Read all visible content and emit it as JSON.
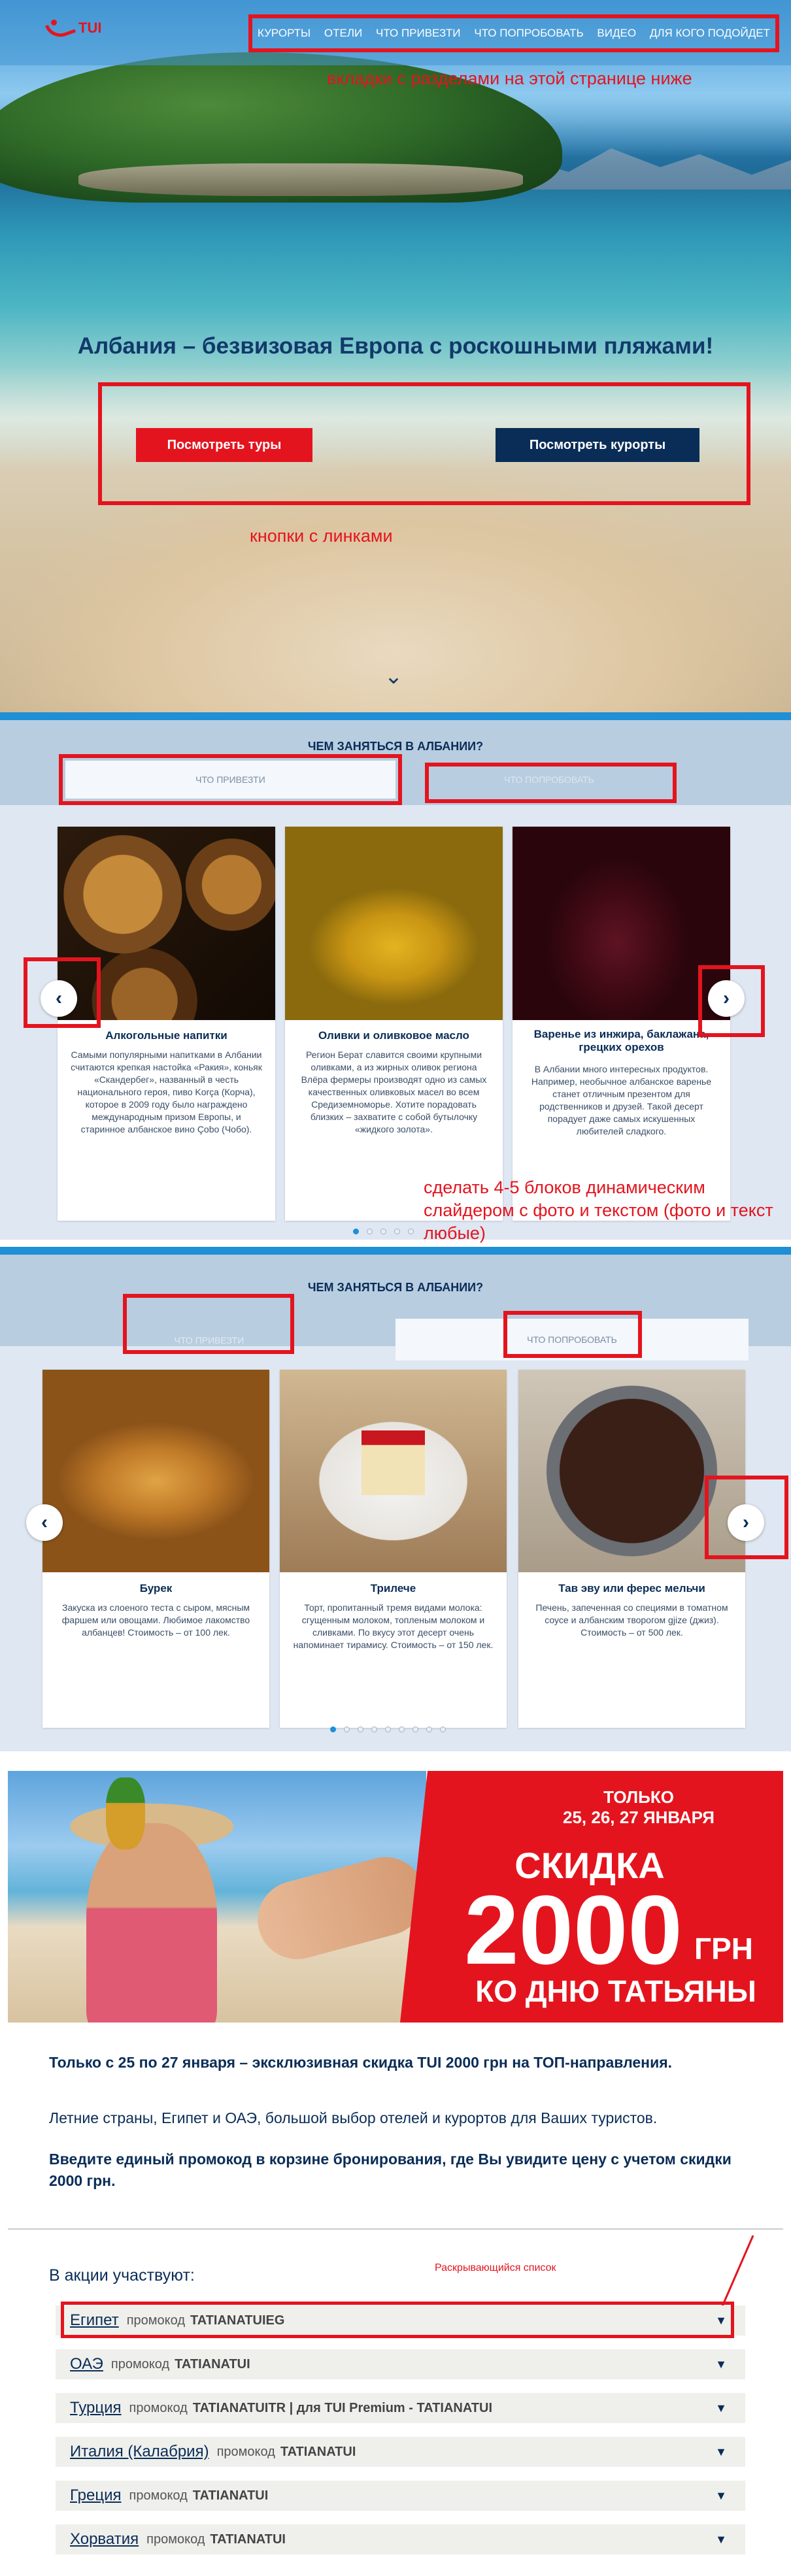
{
  "brand": {
    "logo_text": "TUI"
  },
  "nav": [
    "КУРОРТЫ",
    "ОТЕЛИ",
    "ЧТО ПРИВЕЗТИ",
    "ЧТО ПОПРОБОВАТЬ",
    "ВИДЕО",
    "ДЛЯ КОГО ПОДОЙДЕТ"
  ],
  "annotations": {
    "nav_note": "вкладки с разделами на этой странице ниже",
    "buttons_note": "кнопки с линками",
    "slider_note_1": "сделать 4-5 блоков динамическим",
    "slider_note_2": "слайдером с фото и текстом (фото и текст",
    "slider_note_3": "любые)",
    "dropdown_note": "Раскрывающийся список"
  },
  "hero": {
    "title": "Албания – безвизовая Европа с роскошными пляжами!",
    "btn_tours": "Посмотреть туры",
    "btn_resorts": "Посмотреть курорты",
    "scroll_icon": "chevron-down-icon"
  },
  "section1": {
    "title": "ЧЕМ ЗАНЯТЬСЯ В АЛБАНИИ?",
    "tab_bring": "ЧТО ПРИВЕЗТИ",
    "tab_try": "ЧТО ПОПРОБОВАТЬ",
    "active_tab": "ЧТО ПРИВЕЗТИ",
    "cards": [
      {
        "title": "Алкогольные напитки",
        "text": "Самыми популярными напитками в Албании считаются крепкая настойка «Ракия», коньяк «Скандербег», названный в честь национального героя, пиво Korça (Корча), которое в 2009 году было награждено международным призом Европы, и старинное албанское вино Çobo (Чобо)."
      },
      {
        "title": "Оливки и оливковое масло",
        "text": "Регион Берат славится своими крупными оливками, а из жирных оливок региона Влёра фермеры производят одно из самых качественных оливковых масел во всем Средиземноморье. Хотите порадовать близких – захватите с собой бутылочку «жидкого золота»."
      },
      {
        "title": "Варенье из инжира, баклажана, грецких орехов",
        "text": "В Албании много интересных продуктов. Например, необычное албанское варенье станет отличным презентом для родственников и друзей. Такой десерт порадует даже самых искушенных любителей сладкого."
      }
    ],
    "dots_count": 5,
    "active_dot": 1
  },
  "section2": {
    "title": "ЧЕМ ЗАНЯТЬСЯ В АЛБАНИИ?",
    "tab_bring": "ЧТО ПРИВЕЗТИ",
    "tab_try": "ЧТО ПОПРОБОВАТЬ",
    "active_tab": "ЧТО ПОПРОБОВАТЬ",
    "cards": [
      {
        "title": "Бурек",
        "text": "Закуска из слоеного теста с сыром, мясным фаршем или овощами. Любимое лакомство албанцев! Стоимость – от 100 лек."
      },
      {
        "title": "Трилече",
        "text": "Торт, пропитанный тремя видами молока: сгущенным молоком, топленым молоком и сливками. По вкусу этот десерт очень напоминает тирамису. Стоимость – от 150 лек."
      },
      {
        "title": "Тав эву или ферес мельчи",
        "text": "Печень, запеченная со специями в томатном соусе и албанским творогом gjize (джиз). Стоимость – от 500 лек."
      }
    ],
    "dots_count": 9,
    "active_dot": 1
  },
  "promo": {
    "only": "ТОЛЬКО",
    "dates": "25, 26, 27 ЯНВАРЯ",
    "discount": "СКИДКА",
    "amount": "2000",
    "currency": "ГРН",
    "occasion": "КО ДНЮ ТАТЬЯНЫ"
  },
  "text": {
    "p1": "Только с 25 по 27 января – эксклюзивная скидка TUI 2000 грн на ТОП-направления.",
    "p2": "Летние страны, Египет и ОАЭ, большой выбор отелей и курортов для Ваших туристов.",
    "p3": "Введите единый промокод в корзине бронирования, где Вы увидите цену с учетом скидки 2000 грн."
  },
  "participants": {
    "heading": "В акции участвуют:",
    "items": [
      {
        "country": "Египет",
        "label": "промокод",
        "code": "TATIANATUIEG"
      },
      {
        "country": "ОАЭ",
        "label": "промокод",
        "code": "TATIANATUI"
      },
      {
        "country": "Турция",
        "label": "промокод",
        "code": "TATIANATUITR | для TUI Premium - TATIANATUI"
      },
      {
        "country": "Италия (Калабрия)",
        "label": "промокод",
        "code": "TATIANATUI"
      },
      {
        "country": "Греция",
        "label": "промокод",
        "code": "TATIANATUI"
      },
      {
        "country": "Хорватия",
        "label": "промокод",
        "code": "TATIANATUI"
      }
    ]
  },
  "colors": {
    "accent_red": "#e4141e",
    "navy": "#0a2d57",
    "blue": "#1f8fd6"
  }
}
